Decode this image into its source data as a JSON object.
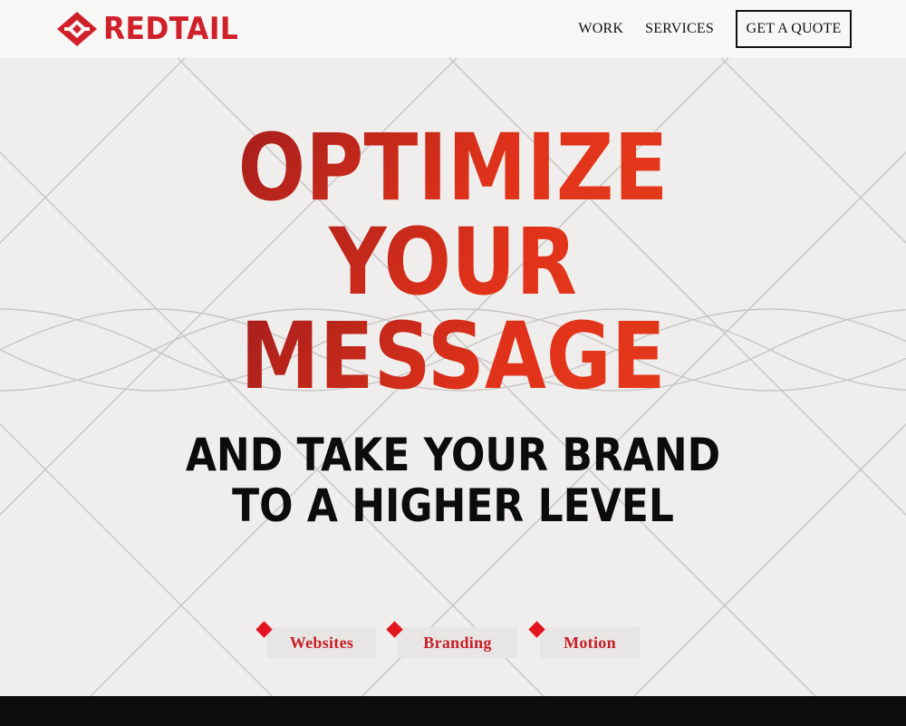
{
  "brand": {
    "name": "REDTAIL",
    "color": "#d0202a"
  },
  "nav": {
    "work": "WORK",
    "services": "SERVICES",
    "quote": "GET A QUOTE"
  },
  "hero": {
    "headline": [
      "OPTIMIZE",
      "YOUR",
      "MESSAGE"
    ],
    "subline": [
      "AND TAKE YOUR BRAND",
      "TO A HIGHER LEVEL"
    ],
    "headline_gradient": [
      "#4a0c0c",
      "#e8401c"
    ],
    "subline_color": "#0c0c0c"
  },
  "tags": [
    "Websites",
    "Branding",
    "Motion"
  ],
  "icons": {
    "logo": "redtail-diamond-logo-icon",
    "tag_marker": "red-diamond-icon"
  },
  "colors": {
    "accent": "#e3141e",
    "background": "#efeeec",
    "footer": "#0c0c0c"
  }
}
